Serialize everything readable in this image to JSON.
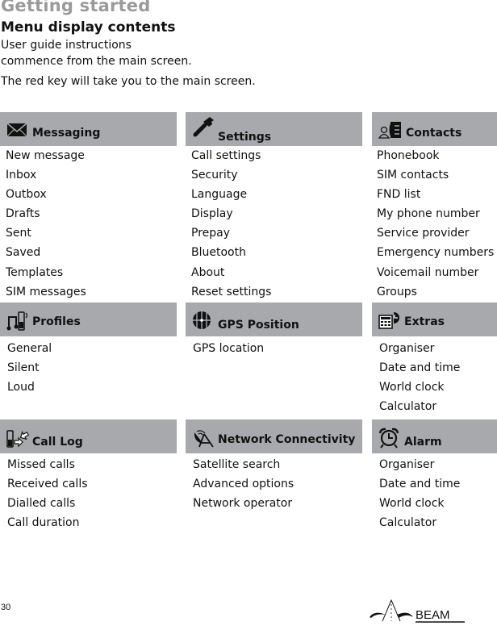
{
  "header": {
    "section": "Getting started",
    "title": "Menu display contents",
    "intro_line1": "User guide instructions",
    "intro_line2": "commence from the main screen.",
    "intro_line3": "The red key will take you to the main screen."
  },
  "menus": [
    {
      "title": "Messaging",
      "icon": "envelope-icon",
      "items": [
        "New message",
        "Inbox",
        "Outbox",
        "Drafts",
        "Sent",
        "Saved",
        "Templates",
        "SIM messages"
      ]
    },
    {
      "title": "Settings",
      "icon": "wrench-icon",
      "items": [
        "Call settings",
        "Security",
        "Language",
        "Display",
        "Prepay",
        "Bluetooth",
        "About",
        "Reset settings"
      ]
    },
    {
      "title": "Contacts",
      "icon": "contacts-book-icon",
      "items": [
        "Phonebook",
        "SIM contacts",
        "FND list",
        "My phone number",
        "Service provider",
        "Emergency numbers",
        "Voicemail number",
        "Groups"
      ]
    },
    {
      "title": "Profiles",
      "icon": "music-phone-icon",
      "items": [
        "General",
        "Silent",
        "Loud"
      ]
    },
    {
      "title": "GPS Position",
      "icon": "globe-icon",
      "items": [
        "GPS location"
      ]
    },
    {
      "title": "Extras",
      "icon": "calculator-clock-icon",
      "items": [
        "Organiser",
        "Date and time",
        "World clock",
        "Calculator"
      ]
    },
    {
      "title": "Call Log",
      "icon": "phone-arrows-icon",
      "items": [
        "Missed calls",
        "Received calls",
        "Dialled calls",
        "Call duration"
      ]
    },
    {
      "title": "Network Connectivity",
      "icon": "satellite-dish-icon",
      "items": [
        "Satellite search",
        "Advanced options",
        "Network operator"
      ]
    },
    {
      "title": "Alarm",
      "icon": "alarm-clock-icon",
      "items": [
        "Organiser",
        "Date and time",
        "World clock",
        "Calculator"
      ]
    }
  ],
  "footer": {
    "page_number": "30",
    "logo_text": "BEAM"
  },
  "colors": {
    "header_bar": "#a7a9ac",
    "section_label": "#9a9a9a",
    "text": "#111111"
  }
}
